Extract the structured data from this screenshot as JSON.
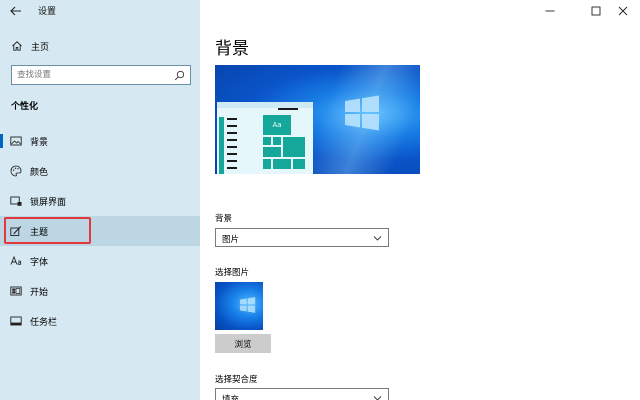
{
  "window": {
    "title": "设置"
  },
  "sidebar": {
    "home_label": "主页",
    "search_placeholder": "查找设置",
    "section_title": "个性化",
    "items": [
      {
        "label": "背景",
        "icon": "picture-icon"
      },
      {
        "label": "颜色",
        "icon": "palette-icon"
      },
      {
        "label": "锁屏界面",
        "icon": "lock-screen-icon"
      },
      {
        "label": "主题",
        "icon": "brush-icon"
      },
      {
        "label": "字体",
        "icon": "font-icon"
      },
      {
        "label": "开始",
        "icon": "start-icon"
      },
      {
        "label": "任务栏",
        "icon": "taskbar-icon"
      }
    ]
  },
  "main": {
    "title": "背景",
    "preview": {
      "tile_text": "Aa"
    },
    "background_label": "背景",
    "background_value": "图片",
    "choose_picture_label": "选择图片",
    "browse_label": "浏览",
    "fit_label": "选择契合度",
    "fit_value": "填充"
  },
  "colors": {
    "sidebar_bg": "#d6e8f1",
    "accent": "#0067c0",
    "highlight": "#e0383e",
    "tile": "#14a79a"
  }
}
